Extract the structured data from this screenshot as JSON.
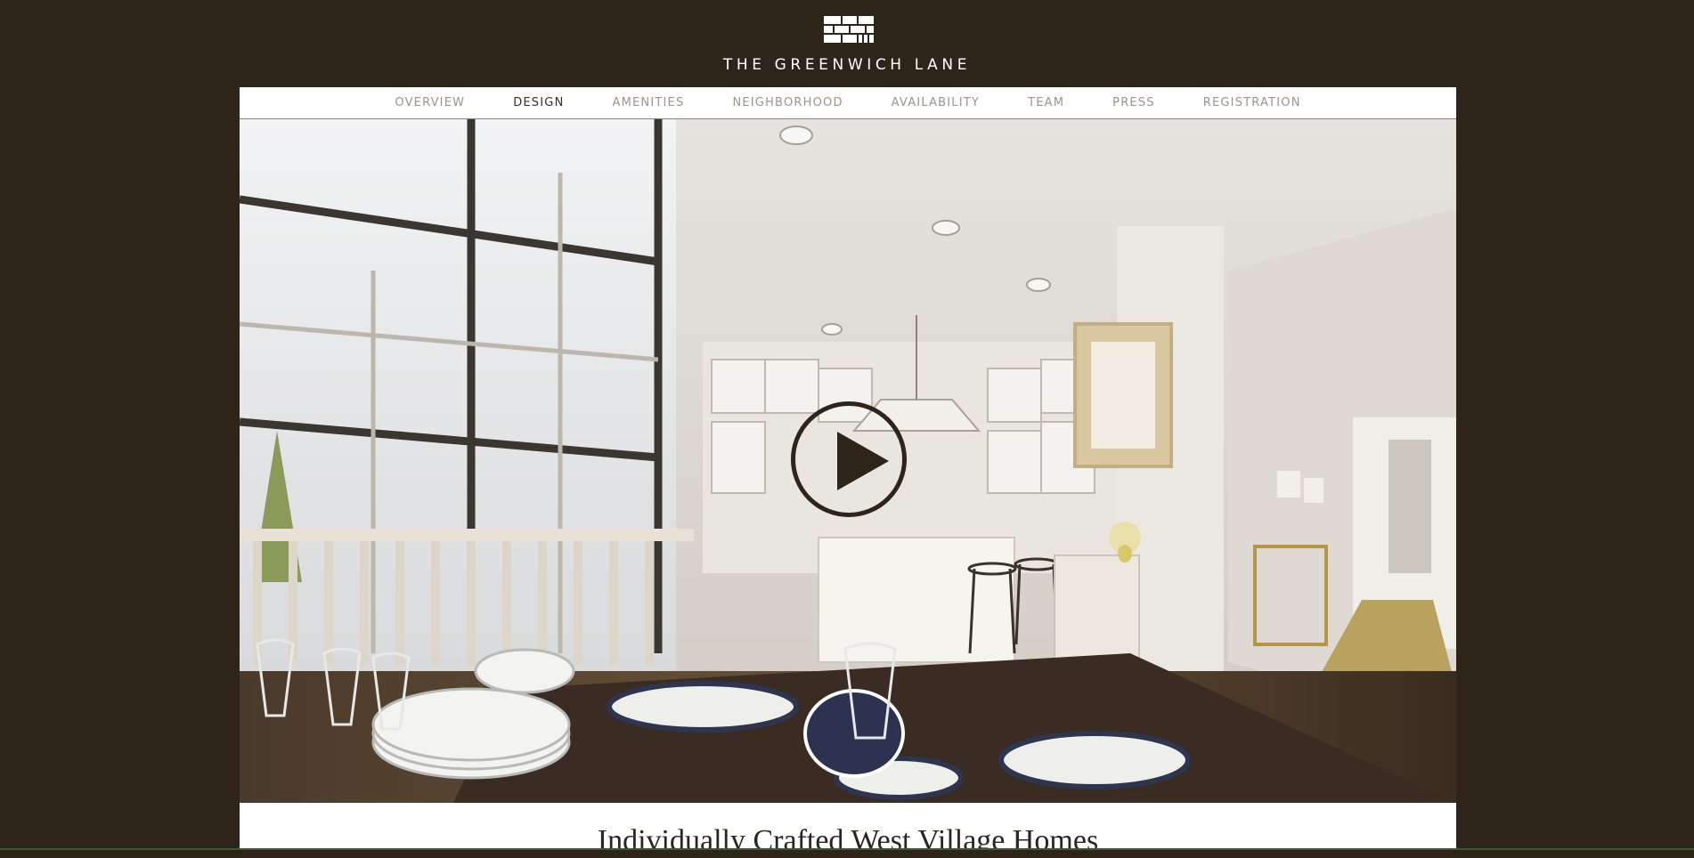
{
  "header": {
    "brand": "THE GREENWICH LANE",
    "logo_icon": "brick-logo-icon"
  },
  "nav": {
    "items": [
      {
        "label": "OVERVIEW",
        "active": false
      },
      {
        "label": "DESIGN",
        "active": true
      },
      {
        "label": "AMENITIES",
        "active": false
      },
      {
        "label": "NEIGHBORHOOD",
        "active": false
      },
      {
        "label": "AVAILABILITY",
        "active": false
      },
      {
        "label": "TEAM",
        "active": false
      },
      {
        "label": "PRESS",
        "active": false
      },
      {
        "label": "REGISTRATION",
        "active": false
      }
    ]
  },
  "hero": {
    "play_icon": "play-icon"
  },
  "main": {
    "headline": "Individually Crafted West Village Homes"
  },
  "colors": {
    "background": "#2e2419",
    "panel": "#ffffff",
    "nav_text": "#9a9490",
    "nav_active": "#3a2f25"
  }
}
